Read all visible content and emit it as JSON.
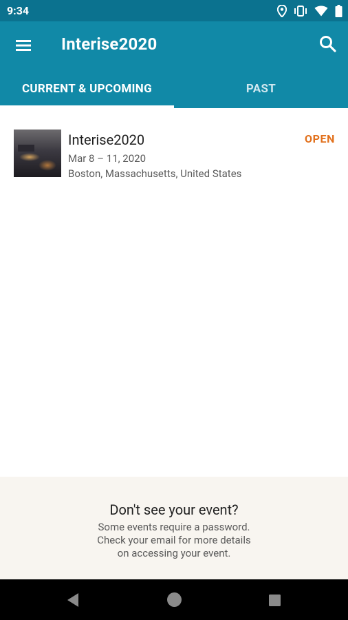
{
  "status_bar": {
    "time": "9:34",
    "icons": [
      "location-icon",
      "vibrate-icon",
      "wifi-icon",
      "battery-icon"
    ]
  },
  "app_bar": {
    "title": "Interise2020",
    "menu_icon": "hamburger-menu-icon",
    "search_icon": "search-icon"
  },
  "tabs": [
    {
      "label": "CURRENT & UPCOMING",
      "selected": true
    },
    {
      "label": "PAST",
      "selected": false
    }
  ],
  "events": [
    {
      "title": "Interise2020",
      "dates": "Mar 8 – 11, 2020",
      "location": "Boston, Massachusetts, United States",
      "status": "OPEN"
    }
  ],
  "footer": {
    "heading": "Don't see your event?",
    "lines": [
      "Some events require a password.",
      "Check your email for more details",
      "on accessing your event."
    ]
  },
  "colors": {
    "status_bar": "#0b728f",
    "app_bar": "#1189a7",
    "status_open": "#e2711d",
    "footer_bg": "#f8f5f0"
  }
}
